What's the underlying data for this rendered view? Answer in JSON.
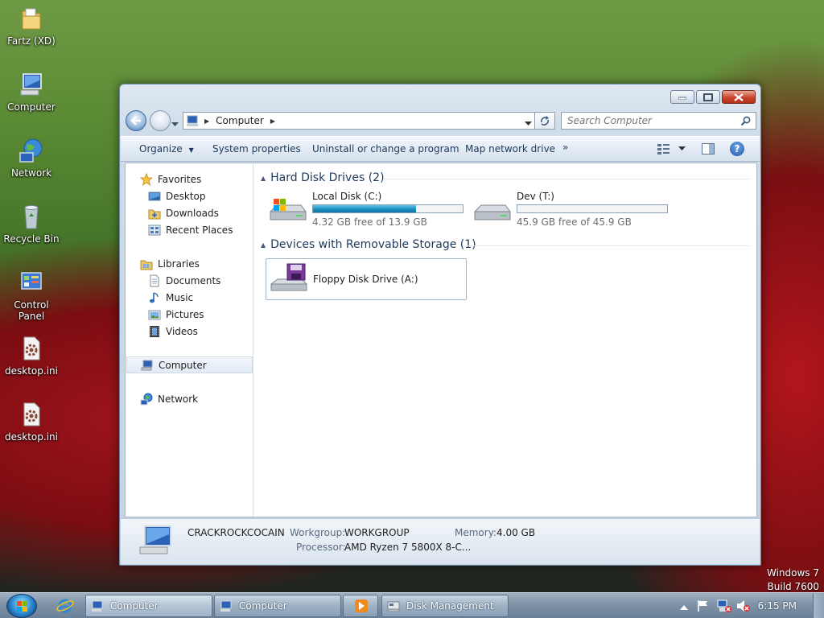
{
  "desktop": {
    "icons": [
      {
        "label": "Fartz (XD)",
        "icon": "folder-icon"
      },
      {
        "label": "Computer",
        "icon": "computer-icon"
      },
      {
        "label": "Network",
        "icon": "network-icon"
      },
      {
        "label": "Recycle Bin",
        "icon": "recycle-bin-icon"
      },
      {
        "label": "Control Panel",
        "icon": "control-panel-icon"
      },
      {
        "label": "desktop.ini",
        "icon": "settings-file-icon"
      },
      {
        "label": "desktop.ini",
        "icon": "settings-file-icon"
      }
    ],
    "watermark": {
      "line1": "Windows 7",
      "line2": "Build 7600"
    }
  },
  "window": {
    "address": {
      "crumb": "Computer",
      "location_icon": "computer-icon"
    },
    "search": {
      "placeholder": "Search Computer"
    },
    "toolbar": {
      "organize": "Organize",
      "system_properties": "System properties",
      "uninstall": "Uninstall or change a program",
      "map_drive": "Map network drive",
      "more": "»"
    },
    "nav": {
      "favorites": "Favorites",
      "desktop": "Desktop",
      "downloads": "Downloads",
      "recent_places": "Recent Places",
      "libraries": "Libraries",
      "documents": "Documents",
      "music": "Music",
      "pictures": "Pictures",
      "videos": "Videos",
      "computer": "Computer",
      "network": "Network"
    },
    "groups": {
      "hard_disks": "Hard Disk Drives (2)",
      "removable": "Devices with Removable Storage (1)"
    },
    "drives": {
      "c": {
        "name": "Local Disk (C:)",
        "free": "4.32 GB free of 13.9 GB",
        "used_fraction": 0.69
      },
      "t": {
        "name": "Dev (T:)",
        "free": "45.9 GB free of 45.9 GB",
        "used_fraction": 0.0
      },
      "a": {
        "name": "Floppy Disk Drive (A:)"
      }
    },
    "details": {
      "computer_name": "CRACKROCKCOCAIN",
      "workgroup_label": "Workgroup:",
      "workgroup_value": "WORKGROUP",
      "memory_label": "Memory:",
      "memory_value": "4.00 GB",
      "processor_label": "Processor:",
      "processor_value": "AMD Ryzen 7 5800X 8-C..."
    }
  },
  "taskbar": {
    "buttons": [
      {
        "label": "Computer",
        "icon": "computer-icon"
      },
      {
        "label": "Computer",
        "icon": "computer-icon"
      },
      {
        "label": "",
        "icon": "media-player-icon"
      },
      {
        "label": "Disk Management",
        "icon": "disk-management-icon"
      }
    ],
    "clock": "6:15 PM"
  }
}
